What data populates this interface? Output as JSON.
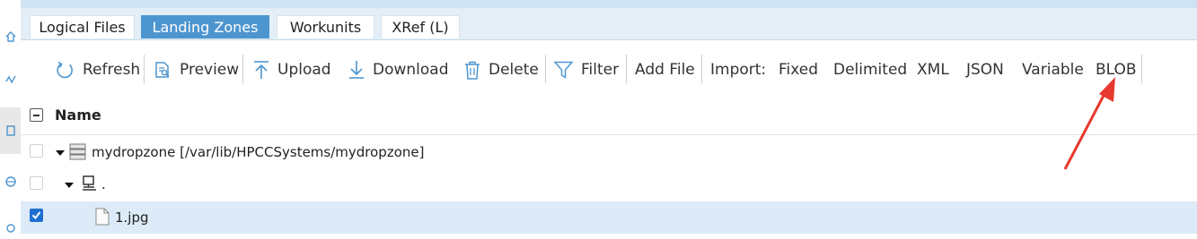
{
  "tabs": [
    {
      "label": "Logical Files",
      "active": false
    },
    {
      "label": "Landing Zones",
      "active": true
    },
    {
      "label": "Workunits",
      "active": false
    },
    {
      "label": "XRef (L)",
      "active": false
    }
  ],
  "toolbar": {
    "refresh": "Refresh",
    "preview": "Preview",
    "upload": "Upload",
    "download": "Download",
    "delete": "Delete",
    "filter": "Filter",
    "add_file": "Add File",
    "import_label": "Import:",
    "fixed": "Fixed",
    "delimited": "Delimited",
    "xml": "XML",
    "json": "JSON",
    "variable": "Variable",
    "blob": "BLOB"
  },
  "grid": {
    "column_name": "Name",
    "rows": [
      {
        "label": "mydropzone [/var/lib/HPCCSystems/mydropzone]",
        "checked": false
      },
      {
        "label": ".",
        "checked": false
      },
      {
        "label": "1.jpg",
        "checked": true
      }
    ]
  },
  "colors": {
    "accent": "#4d95cf",
    "tabbar_bg": "#e3eef7",
    "selected_row": "#dcebf7",
    "annotation_arrow": "#e8392e"
  }
}
